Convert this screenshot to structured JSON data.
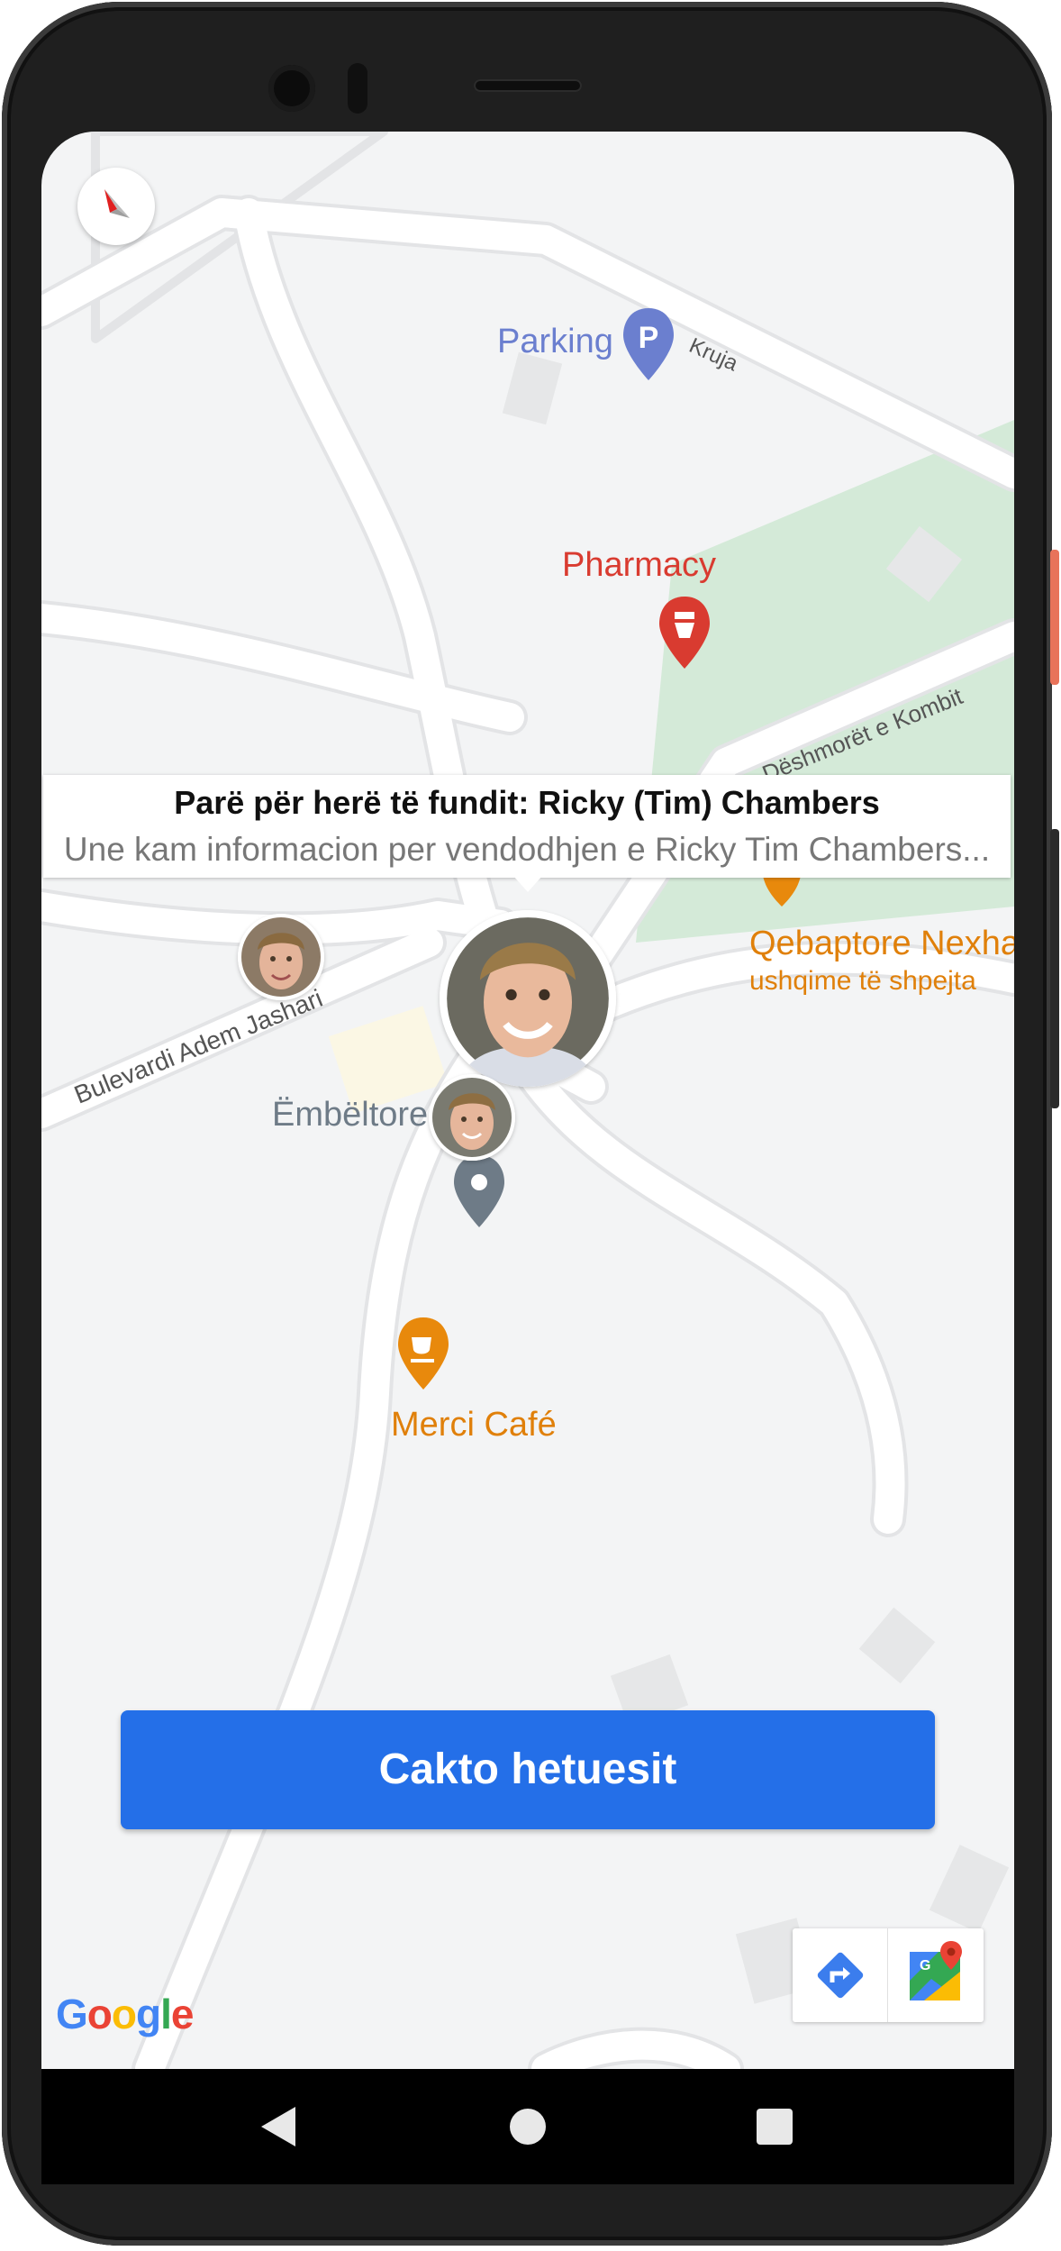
{
  "map": {
    "places": {
      "parking": "Parking",
      "pharmacy": "Pharmacy",
      "qebaptore_name": "Qebaptore Nexhat",
      "qebaptore_category": "ushqime të shpejta",
      "embeltore": "Ëmbëltore",
      "merci_cafe": "Merci Café"
    },
    "streets": {
      "kruja": "Kruja",
      "deshmoret": "Dëshmorët e Kombit",
      "bulevardi": "Bulevardi Adem Jashari"
    },
    "colors": {
      "parking": "#6b7fcf",
      "pharmacy": "#d93b30",
      "food": "#e8890c",
      "dessert": "#6e7b87",
      "park": "#d4ead8",
      "road": "#ffffff",
      "land": "#f3f4f5"
    }
  },
  "info_window": {
    "title": "Parë për herë të fundit: Ricky (Tim) Chambers",
    "snippet": "Une kam informacion per vendodhjen e Ricky Tim Chambers..."
  },
  "cta": {
    "label": "Cakto hetuesit"
  },
  "brand": {
    "logo_text": "Google"
  },
  "icons": {
    "compass": "compass-icon",
    "directions": "directions-icon",
    "open_in_maps": "google-maps-icon",
    "back": "back-icon",
    "home": "home-icon",
    "recents": "recents-icon"
  }
}
